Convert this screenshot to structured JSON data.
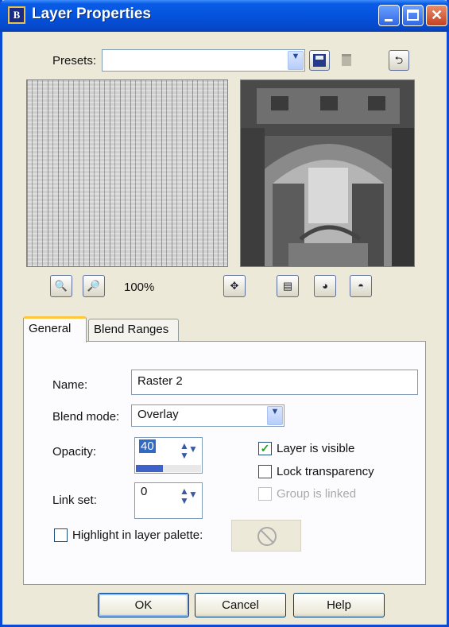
{
  "window": {
    "title": "Layer Properties",
    "app_icon_text": "B",
    "controls": [
      "minimize",
      "maximize",
      "close"
    ]
  },
  "presets": {
    "label": "Presets:",
    "value": "",
    "icons": [
      "save-icon",
      "delete-icon",
      "reset-icon"
    ]
  },
  "preview": {
    "zoom_level": "100%",
    "zoom_out_icon": "zoom-out-icon",
    "zoom_in_icon": "zoom-in-icon",
    "pan_icon": "move-icon"
  },
  "tabs": [
    {
      "label": "General",
      "active": true
    },
    {
      "label": "Blend Ranges",
      "active": false
    }
  ],
  "general": {
    "name_label": "Name:",
    "name_value": "Raster 2",
    "blend_mode_label": "Blend mode:",
    "blend_mode_value": "Overlay",
    "opacity_label": "Opacity:",
    "opacity_value": "40",
    "opacity_fraction": 0.4,
    "link_set_label": "Link set:",
    "link_set_value": "0",
    "layer_visible": {
      "label": "Layer is visible",
      "checked": true
    },
    "lock_transparency": {
      "label": "Lock transparency",
      "checked": false
    },
    "group_linked": {
      "label": "Group is linked",
      "checked": false,
      "enabled": false
    },
    "highlight": {
      "label": "Highlight in layer palette:",
      "checked": false
    }
  },
  "buttons": {
    "ok": "OK",
    "cancel": "Cancel",
    "help": "Help"
  },
  "colors": {
    "title_bar": "#0453dd",
    "dialog_bg": "#ece9d8",
    "tab_accent": "#ffc83c",
    "selection": "#316ac5"
  }
}
